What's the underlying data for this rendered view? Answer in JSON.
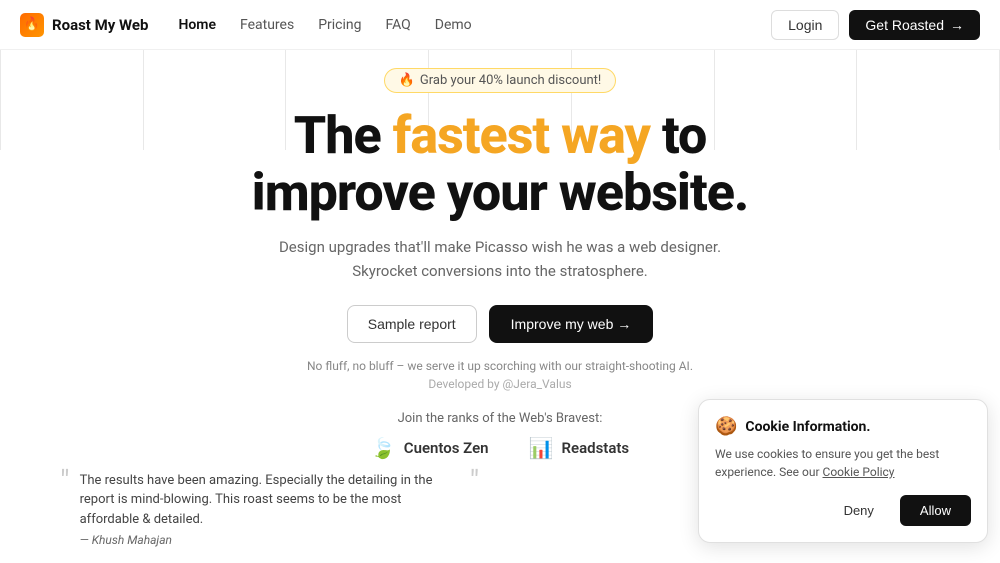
{
  "navbar": {
    "logo_icon": "🔥",
    "logo_text": "Roast My Web",
    "links": [
      {
        "label": "Home",
        "active": true
      },
      {
        "label": "Features",
        "active": false
      },
      {
        "label": "Pricing",
        "active": false
      },
      {
        "label": "FAQ",
        "active": false
      },
      {
        "label": "Demo",
        "active": false
      }
    ],
    "login_label": "Login",
    "cta_label": "Get Roasted",
    "cta_arrow": "→"
  },
  "hero": {
    "badge_icon": "🔥",
    "badge_text": "Grab your 40% launch discount!",
    "heading_part1": "The ",
    "heading_highlight1": "fastest",
    "heading_part2": " ",
    "heading_highlight2": "way",
    "heading_part3": " to",
    "heading_line2": "improve your website.",
    "subtitle_line1": "Design upgrades that'll make Picasso wish he was a web designer.",
    "subtitle_line2": "Skyrocket conversions into the stratosphere.",
    "btn_sample": "Sample report",
    "btn_improve": "Improve my web →",
    "trust_text": "No fluff, no bluff – we serve it up scorching with our straight-shooting AI.",
    "developed_by": "Developed by @Jera_Valus"
  },
  "social_proof": {
    "label": "Join the ranks of the Web's Bravest:",
    "logos": [
      {
        "icon": "🍃",
        "name": "Cuentos Zen"
      },
      {
        "icon": "📊",
        "name": "Readstats"
      }
    ]
  },
  "testimonial": {
    "text": "The results have been amazing. Especially the detailing in the report is mind-blowing. This roast seems to be the most affordable & detailed.",
    "author": "— Khush Mahajan"
  },
  "cookie": {
    "emoji": "🍪",
    "title": "Cookie Information.",
    "body": "We use cookies to ensure you get the best experience. See our",
    "link_text": "Cookie Policy",
    "allow_label": "Allow",
    "deny_label": "Deny"
  }
}
